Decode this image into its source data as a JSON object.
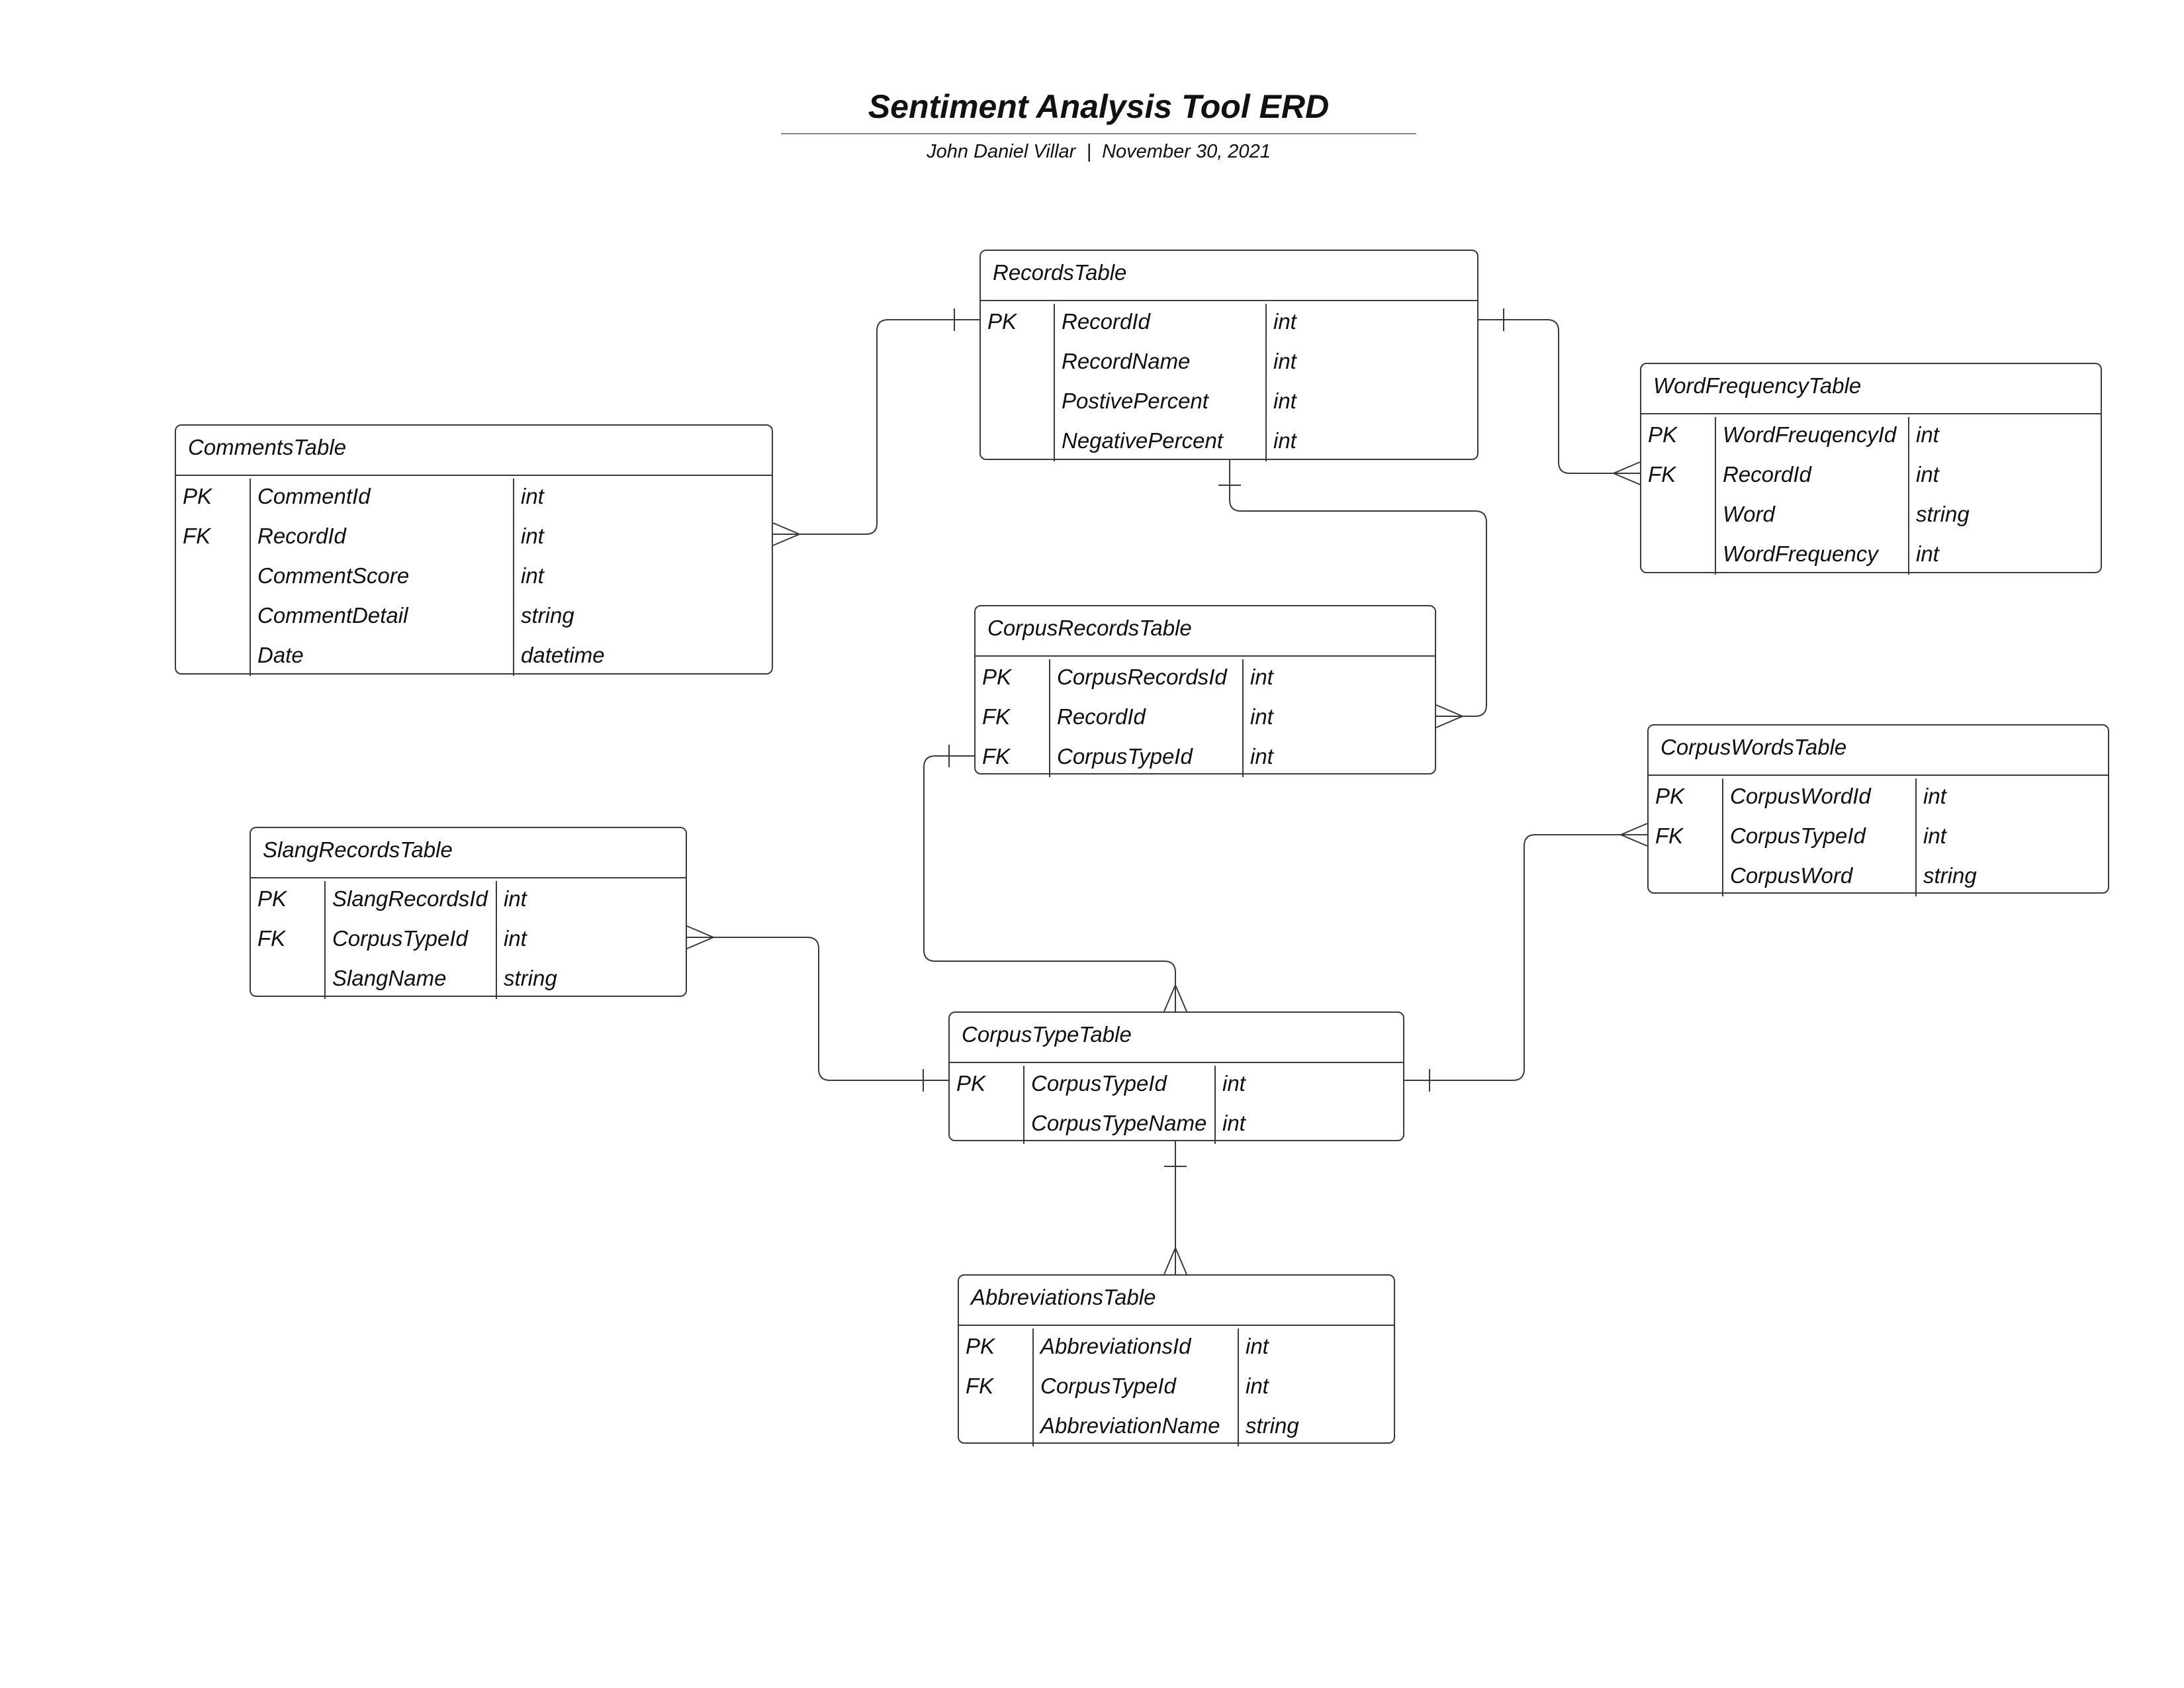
{
  "header": {
    "title": "Sentiment Analysis Tool ERD",
    "author": "John Daniel Villar",
    "separator": "|",
    "date": "November 30, 2021"
  },
  "tables": {
    "records": {
      "name": "RecordsTable",
      "rows": [
        {
          "key": "PK",
          "field": "RecordId",
          "type": "int"
        },
        {
          "key": "",
          "field": "RecordName",
          "type": "int"
        },
        {
          "key": "",
          "field": "PostivePercent",
          "type": "int"
        },
        {
          "key": "",
          "field": "NegativePercent",
          "type": "int"
        }
      ]
    },
    "comments": {
      "name": "CommentsTable",
      "rows": [
        {
          "key": "PK",
          "field": "CommentId",
          "type": "int"
        },
        {
          "key": "FK",
          "field": "RecordId",
          "type": "int"
        },
        {
          "key": "",
          "field": "CommentScore",
          "type": "int"
        },
        {
          "key": "",
          "field": "CommentDetail",
          "type": "string"
        },
        {
          "key": "",
          "field": "Date",
          "type": "datetime"
        }
      ]
    },
    "word_frequency": {
      "name": "WordFrequencyTable",
      "rows": [
        {
          "key": "PK",
          "field": "WordFreuqencyId",
          "type": "int"
        },
        {
          "key": "FK",
          "field": "RecordId",
          "type": "int"
        },
        {
          "key": "",
          "field": "Word",
          "type": "string"
        },
        {
          "key": "",
          "field": "WordFrequency",
          "type": "int"
        }
      ]
    },
    "corpus_records": {
      "name": "CorpusRecordsTable",
      "rows": [
        {
          "key": "PK",
          "field": "CorpusRecordsId",
          "type": "int"
        },
        {
          "key": "FK",
          "field": "RecordId",
          "type": "int"
        },
        {
          "key": "FK",
          "field": "CorpusTypeId",
          "type": "int"
        }
      ]
    },
    "corpus_words": {
      "name": "CorpusWordsTable",
      "rows": [
        {
          "key": "PK",
          "field": "CorpusWordId",
          "type": "int"
        },
        {
          "key": "FK",
          "field": "CorpusTypeId",
          "type": "int"
        },
        {
          "key": "",
          "field": "CorpusWord",
          "type": "string"
        }
      ]
    },
    "slang_records": {
      "name": "SlangRecordsTable",
      "rows": [
        {
          "key": "PK",
          "field": "SlangRecordsId",
          "type": "int"
        },
        {
          "key": "FK",
          "field": "CorpusTypeId",
          "type": "int"
        },
        {
          "key": "",
          "field": "SlangName",
          "type": "string"
        }
      ]
    },
    "corpus_type": {
      "name": "CorpusTypeTable",
      "rows": [
        {
          "key": "PK",
          "field": "CorpusTypeId",
          "type": "int"
        },
        {
          "key": "",
          "field": "CorpusTypeName",
          "type": "int"
        }
      ]
    },
    "abbreviations": {
      "name": "AbbreviationsTable",
      "rows": [
        {
          "key": "PK",
          "field": "AbbreviationsId",
          "type": "int"
        },
        {
          "key": "FK",
          "field": "CorpusTypeId",
          "type": "int"
        },
        {
          "key": "",
          "field": "AbbreviationName",
          "type": "string"
        }
      ]
    }
  },
  "relationships": [
    {
      "from": "records",
      "to": "comments",
      "from_end": "one",
      "to_end": "many"
    },
    {
      "from": "records",
      "to": "word_frequency",
      "from_end": "one",
      "to_end": "many"
    },
    {
      "from": "records",
      "to": "corpus_records",
      "from_end": "one",
      "to_end": "many"
    },
    {
      "from": "corpus_records",
      "to": "corpus_type",
      "from_end": "one",
      "to_end": "many"
    },
    {
      "from": "corpus_type",
      "to": "slang_records",
      "from_end": "one",
      "to_end": "many"
    },
    {
      "from": "corpus_type",
      "to": "corpus_words",
      "from_end": "one",
      "to_end": "many"
    },
    {
      "from": "corpus_type",
      "to": "abbreviations",
      "from_end": "one",
      "to_end": "many"
    }
  ],
  "colors": {
    "line": "#3a3a3a",
    "title_rule": "#888888"
  }
}
